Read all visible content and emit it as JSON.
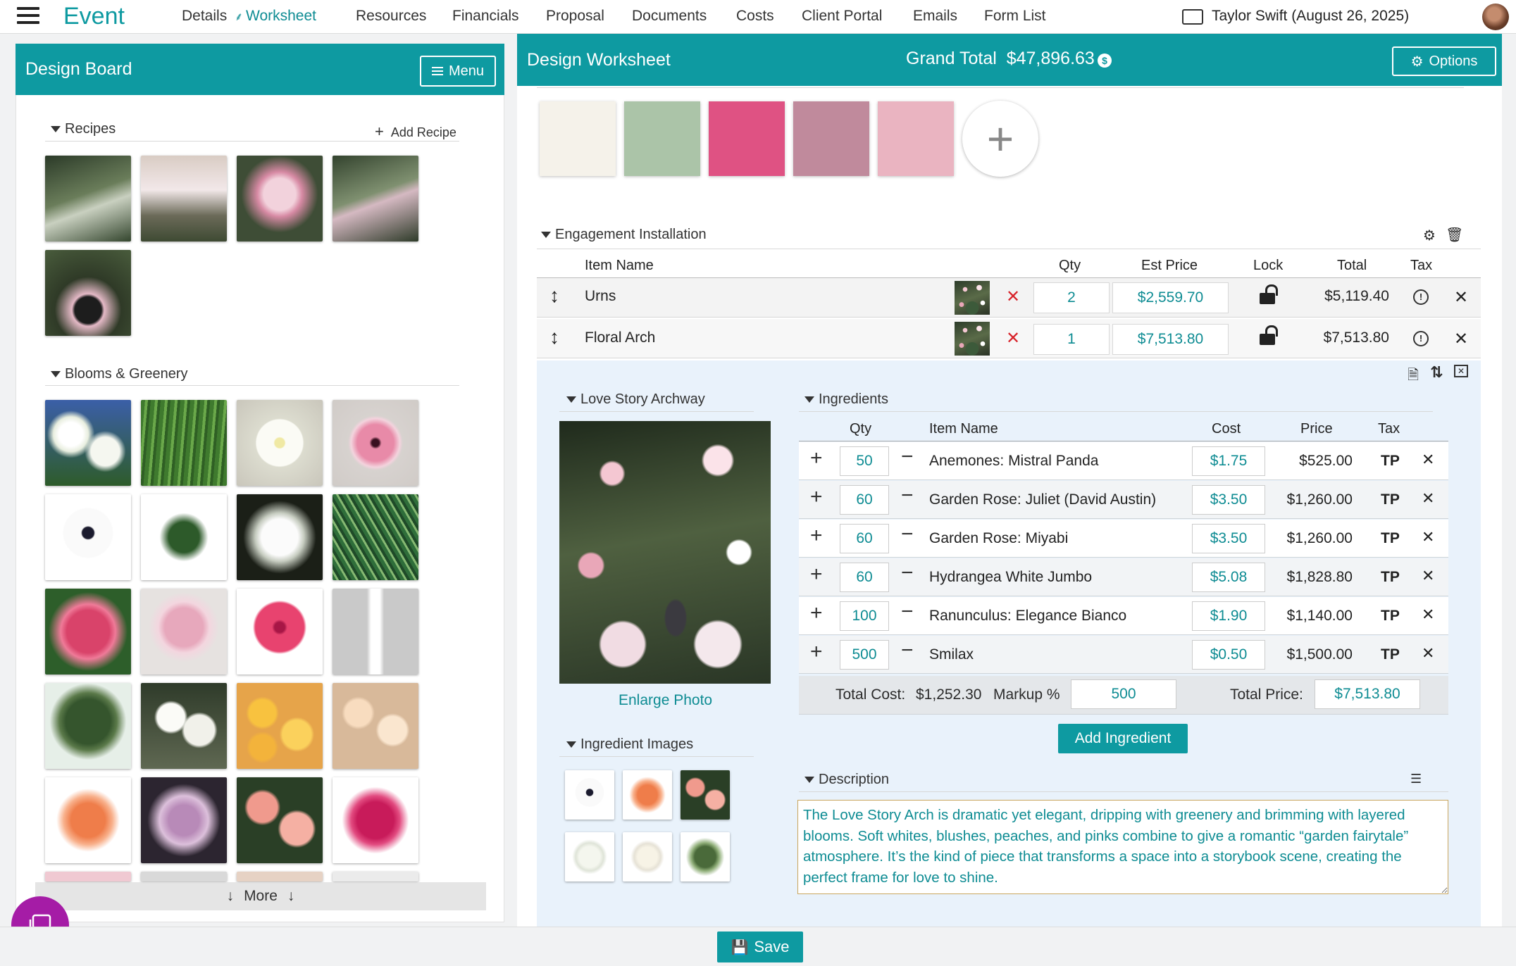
{
  "nav": {
    "brand": "Event",
    "links": [
      "Details",
      "Worksheet",
      "Resources",
      "Financials",
      "Proposal",
      "Documents",
      "Costs",
      "Client Portal",
      "Emails",
      "Form List"
    ],
    "active": "Worksheet",
    "user": "Taylor Swift (August 26, 2025)"
  },
  "design_board": {
    "title": "Design Board",
    "menu_label": "Menu",
    "recipes_label": "Recipes",
    "add_recipe_label": "Add Recipe",
    "blooms_label": "Blooms & Greenery",
    "more_label": "More"
  },
  "worksheet": {
    "title": "Design Worksheet",
    "grand_total_label": "Grand Total",
    "grand_total_value": "$47,896.63",
    "options_label": "Options",
    "swatches": [
      "#f5f2ea",
      "#abc4a8",
      "#df5283",
      "#c08a9c",
      "#eab4c1"
    ],
    "section_title": "Engagement Installation",
    "columns": {
      "item_name": "Item Name",
      "qty": "Qty",
      "est_price": "Est Price",
      "lock": "Lock",
      "total": "Total",
      "tax": "Tax"
    },
    "items": [
      {
        "name": "Urns",
        "qty": "2",
        "est_price": "$2,559.70",
        "total": "$5,119.40"
      },
      {
        "name": "Floral Arch",
        "qty": "1",
        "est_price": "$7,513.80",
        "total": "$7,513.80"
      }
    ]
  },
  "recipe": {
    "name": "Love Story Archway",
    "enlarge_label": "Enlarge Photo",
    "ingredient_images_label": "Ingredient Images",
    "ingredients_label": "Ingredients",
    "ing_columns": {
      "qty": "Qty",
      "item_name": "Item Name",
      "cost": "Cost",
      "price": "Price",
      "tax": "Tax"
    },
    "ingredients": [
      {
        "qty": "50",
        "name": "Anemones: Mistral Panda",
        "cost": "$1.75",
        "price": "$525.00",
        "tax": "TP"
      },
      {
        "qty": "60",
        "name": "Garden Rose: Juliet (David Austin)",
        "cost": "$3.50",
        "price": "$1,260.00",
        "tax": "TP"
      },
      {
        "qty": "60",
        "name": "Garden Rose: Miyabi",
        "cost": "$3.50",
        "price": "$1,260.00",
        "tax": "TP"
      },
      {
        "qty": "60",
        "name": "Hydrangea White Jumbo",
        "cost": "$5.08",
        "price": "$1,828.80",
        "tax": "TP"
      },
      {
        "qty": "100",
        "name": "Ranunculus: Elegance Bianco",
        "cost": "$1.90",
        "price": "$1,140.00",
        "tax": "TP"
      },
      {
        "qty": "500",
        "name": "Smilax",
        "cost": "$0.50",
        "price": "$1,500.00",
        "tax": "TP"
      }
    ],
    "total_cost_label": "Total Cost:",
    "total_cost_value": "$1,252.30",
    "markup_label": "Markup %",
    "markup_value": "500",
    "total_price_label": "Total Price:",
    "total_price_value": "$7,513.80",
    "add_ingredient_label": "Add Ingredient",
    "description_label": "Description",
    "description": "The Love Story Arch is dramatic yet elegant, dripping with greenery and brimming with layered blooms. Soft whites, blushes, peaches, and pinks combine to give a romantic “garden fairytale” atmosphere. It’s the kind of piece that transforms a space into a storybook scene, creating the perfect frame for love to shine."
  },
  "footer": {
    "save_label": "Save"
  }
}
